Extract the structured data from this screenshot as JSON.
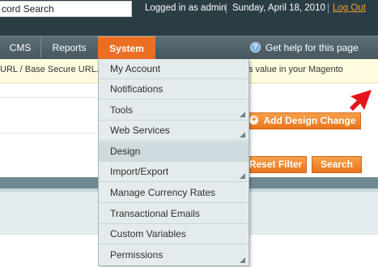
{
  "header": {
    "search_value": "cord Search",
    "user_text": "Logged in as admin",
    "date_text": "Sunday, April 18, 2010",
    "logout_label": "Log Out"
  },
  "nav": {
    "items": [
      {
        "label": "CMS"
      },
      {
        "label": "Reports"
      },
      {
        "label": "System"
      }
    ],
    "help_label": "Get help for this page"
  },
  "notice": {
    "left_text": "URL / Base Secure URL.",
    "right_text": "s value in your Magento"
  },
  "buttons": {
    "add_design_change": "Add Design Change",
    "reset_filter": "Reset Filter",
    "search": "Search"
  },
  "dropdown": {
    "items": [
      {
        "label": "My Account",
        "has_submenu": false
      },
      {
        "label": "Notifications",
        "has_submenu": false
      },
      {
        "label": "Tools",
        "has_submenu": true
      },
      {
        "label": "Web Services",
        "has_submenu": true
      },
      {
        "label": "Design",
        "has_submenu": false
      },
      {
        "label": "Import/Export",
        "has_submenu": true
      },
      {
        "label": "Manage Currency Rates",
        "has_submenu": false
      },
      {
        "label": "Transactional Emails",
        "has_submenu": false
      },
      {
        "label": "Custom Variables",
        "has_submenu": false
      },
      {
        "label": "Permissions",
        "has_submenu": true
      }
    ]
  },
  "colors": {
    "header_bg": "#2b3d44",
    "nav_active": "#ec6e23",
    "accent_orange": "#e9751c",
    "logout_link": "#f39f30",
    "annotation_arrow": "#e5131b"
  },
  "icons": {
    "help": "help-circle-icon",
    "add": "plus-circle-icon",
    "annotation": "red-arrow-icon",
    "submenu": "submenu-corner-arrow-icon"
  }
}
